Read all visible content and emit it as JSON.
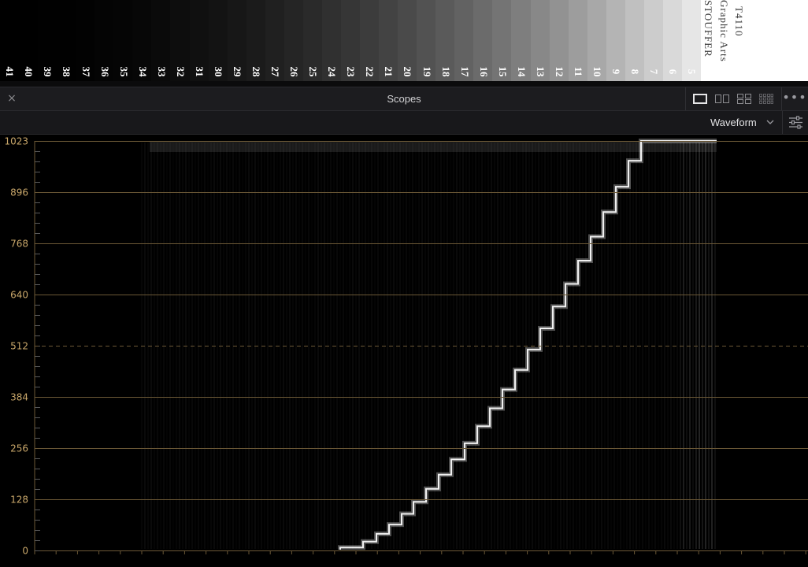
{
  "step_wedge": {
    "step_numbers": [
      "41",
      "40",
      "39",
      "38",
      "37",
      "36",
      "35",
      "34",
      "33",
      "32",
      "31",
      "30",
      "29",
      "28",
      "27",
      "26",
      "25",
      "24",
      "23",
      "22",
      "21",
      "20",
      "19",
      "18",
      "17",
      "16",
      "15",
      "14",
      "13",
      "12",
      "11",
      "10",
      "9",
      "8",
      "7",
      "6",
      "5"
    ],
    "brand_lines": [
      "STOUFFER",
      "Graphic Arts",
      "T4110"
    ]
  },
  "scopes_panel": {
    "title": "Scopes",
    "close_glyph": "×",
    "more_glyph": "•••",
    "layouts": [
      "single-view-icon",
      "dual-view-icon",
      "quad-view-icon",
      "grid-view-icon"
    ],
    "selected_layout": 0,
    "scope_type": "Waveform",
    "settings_icon": "settings-sliders-icon"
  },
  "waveform": {
    "scale_labels": [
      "1023",
      "896",
      "768",
      "640",
      "512",
      "384",
      "256",
      "128",
      "0"
    ],
    "scale_values": [
      1023,
      896,
      768,
      640,
      512,
      384,
      256,
      128,
      0
    ],
    "scale_max": 1023,
    "dashed_level": 512,
    "colors": {
      "graticule": "#6b5836",
      "label": "#c9a76a",
      "trace": "#ffffff"
    }
  }
}
